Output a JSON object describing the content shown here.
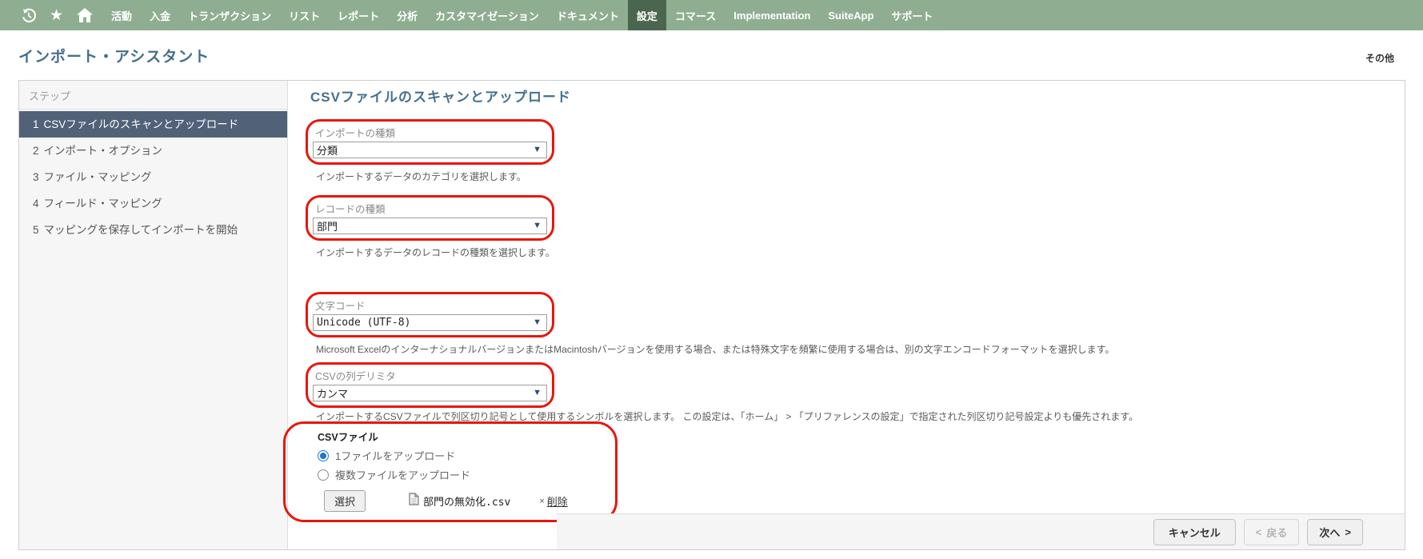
{
  "colors": {
    "nav_bg": "#8fae91",
    "nav_active_bg": "#4b664e",
    "title_blue": "#44708d",
    "active_step_bg": "#516177",
    "annotation_red": "#e8160c",
    "radio_accent": "#1d76d2",
    "caret_navy": "#2d4e71"
  },
  "nav": {
    "items": [
      {
        "label": "活動"
      },
      {
        "label": "入金"
      },
      {
        "label": "トランザクション"
      },
      {
        "label": "リスト"
      },
      {
        "label": "レポート"
      },
      {
        "label": "分析"
      },
      {
        "label": "カスタマイゼーション"
      },
      {
        "label": "ドキュメント"
      },
      {
        "label": "設定",
        "active": true
      },
      {
        "label": "コマース"
      },
      {
        "label": "Implementation"
      },
      {
        "label": "SuiteApp"
      },
      {
        "label": "サポート"
      }
    ],
    "star_glyph": "★"
  },
  "page": {
    "title": "インポート・アシスタント",
    "more_label": "その他"
  },
  "sidebar": {
    "header": "ステップ",
    "steps": [
      {
        "number": "1",
        "label": "CSVファイルのスキャンとアップロード",
        "active": true
      },
      {
        "number": "2",
        "label": "インポート・オプション",
        "active": false
      },
      {
        "number": "3",
        "label": "ファイル・マッピング",
        "active": false
      },
      {
        "number": "4",
        "label": "フィールド・マッピング",
        "active": false
      },
      {
        "number": "5",
        "label": "マッピングを保存してインポートを開始",
        "active": false
      }
    ]
  },
  "main": {
    "heading": "CSVファイルのスキャンとアップロード",
    "caret_glyph": "▼",
    "fields": [
      {
        "label": "インポートの種類",
        "value": "分類",
        "description": "インポートするデータのカテゴリを選択します。"
      },
      {
        "label": "レコードの種類",
        "value": "部門",
        "description": "インポートするデータのレコードの種類を選択します。"
      },
      {
        "label": "文字コード",
        "value": "Unicode (UTF-8)",
        "description": "Microsoft ExcelのインターナショナルバージョンまたはMacintoshバージョンを使用する場合、または特殊文字を頻繁に使用する場合は、別の文字エンコードフォーマットを選択します。"
      },
      {
        "label": "CSVの列デリミタ",
        "value": "カンマ",
        "description": "インポートするCSVファイルで列区切り記号として使用するシンボルを選択します。 この設定は、「ホーム」 > 「プリファレンスの設定」で指定された列区切り記号設定よりも優先されます。"
      }
    ],
    "csv_file": {
      "label": "CSVファイル",
      "options": [
        {
          "label": "1ファイルをアップロード",
          "selected": true
        },
        {
          "label": "複数ファイルをアップロード",
          "selected": false
        }
      ],
      "select_button": "選択",
      "file_name": "部門の無効化.csv",
      "delete_mark": "×",
      "delete_label": "削除"
    }
  },
  "footer": {
    "cancel_label": "キャンセル",
    "back_chevron": "<",
    "back_label": "戻る",
    "next_label": "次へ",
    "next_chevron": ">"
  }
}
